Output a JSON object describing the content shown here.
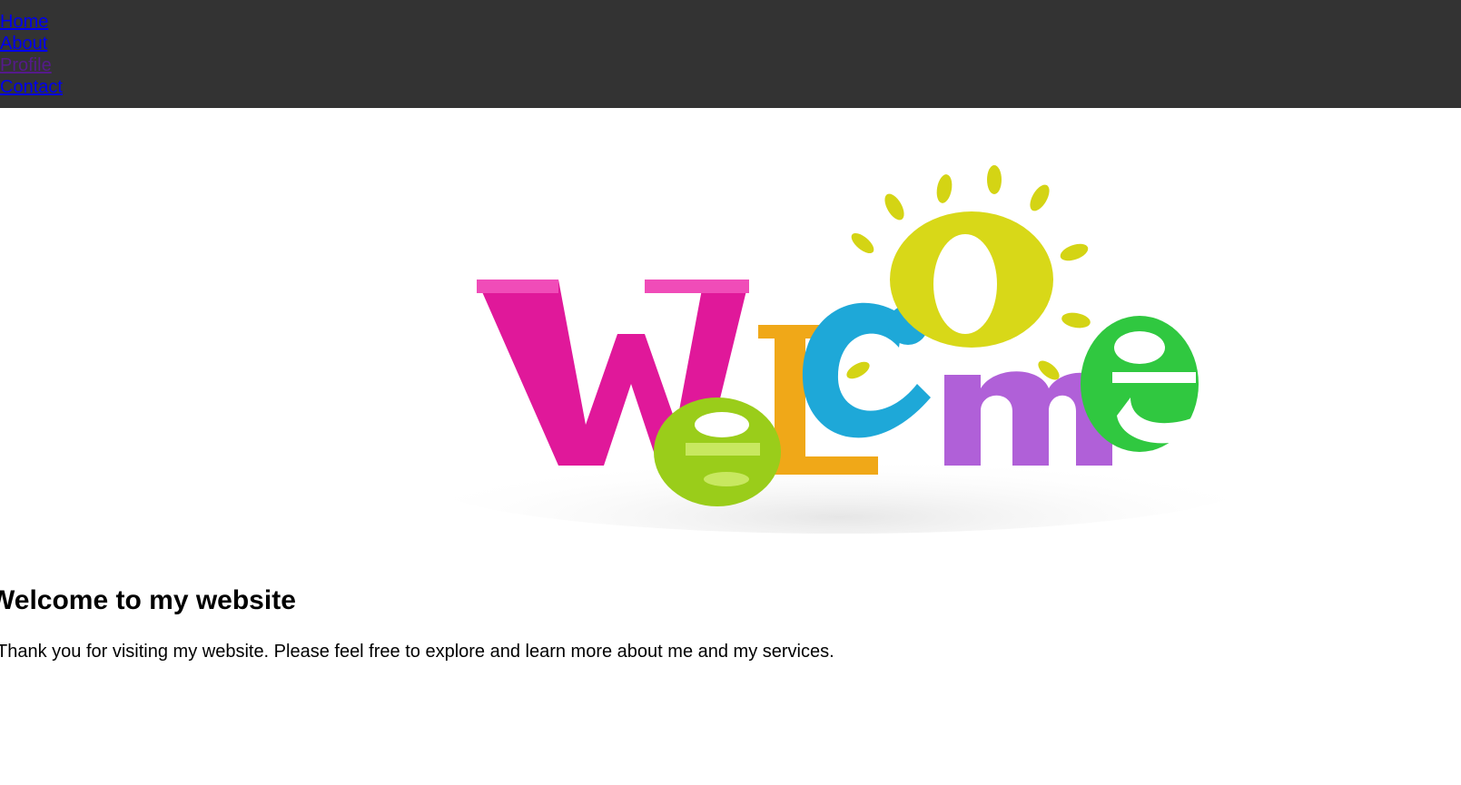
{
  "nav": {
    "items": [
      {
        "label": "Home",
        "visited": false
      },
      {
        "label": "About",
        "visited": false
      },
      {
        "label": "Profile",
        "visited": true
      },
      {
        "label": "Contact",
        "visited": false
      }
    ],
    "background": "#333333"
  },
  "hero": {
    "image_text": "WELCOME",
    "letter_colors": [
      "#e0189a",
      "#9acd1a",
      "#f0a818",
      "#1ea8d8",
      "#d8d818",
      "#b060d8",
      "#30c840"
    ]
  },
  "main": {
    "heading": "Welcome to my website",
    "intro": "Thank you for visiting my website. Please feel free to explore and learn more about me and my services."
  }
}
